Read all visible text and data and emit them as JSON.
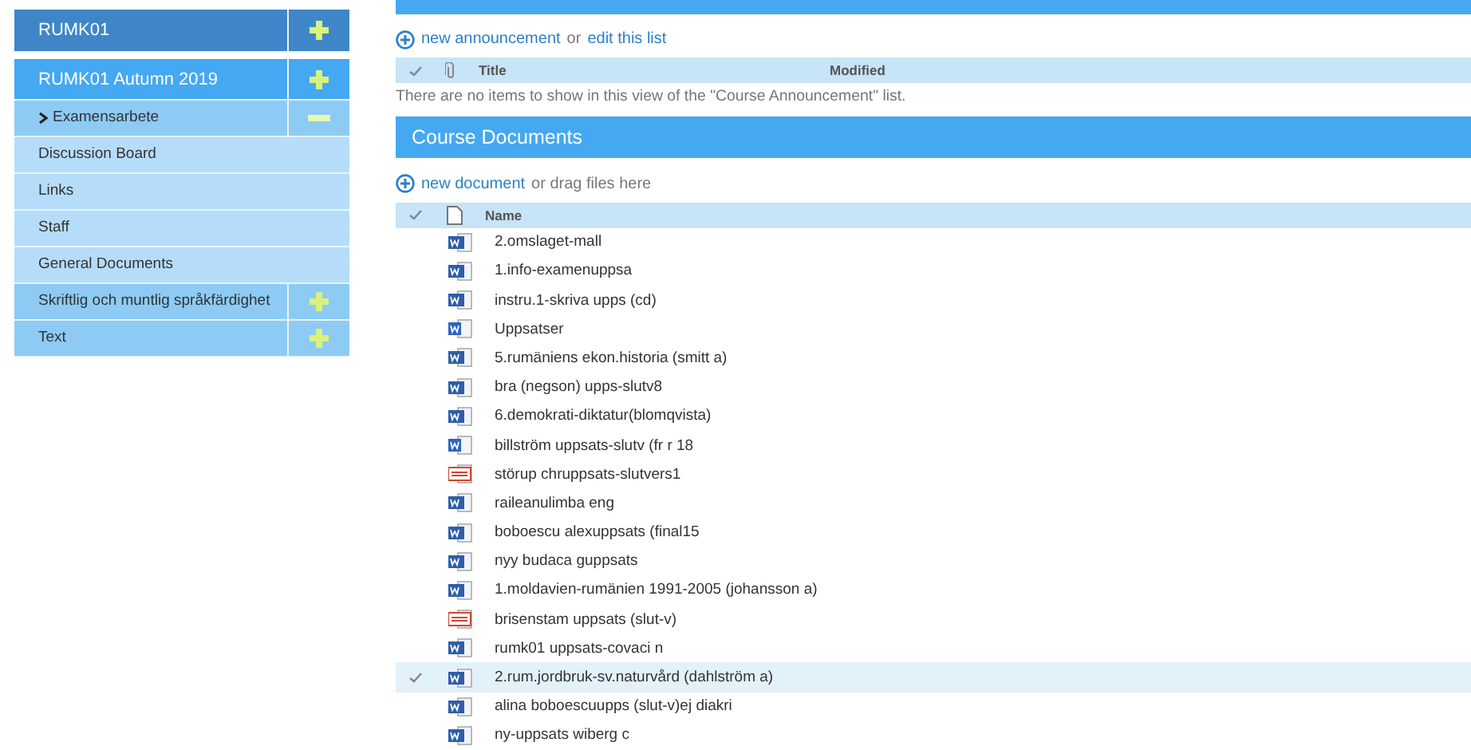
{
  "sidebar": {
    "items": [
      {
        "label": "RUMK01",
        "selected": false,
        "expanded": false,
        "children": [
          {
            "label": "RUMK01 Autumn 2019",
            "selected": false,
            "expanded": false,
            "children": [
              {
                "label": "Examensarbete",
                "selected": true,
                "expanded": true,
                "children": [
                  {
                    "label": "Discussion Board",
                    "selected": false
                  },
                  {
                    "label": "Links",
                    "selected": false
                  },
                  {
                    "label": "Staff",
                    "selected": false
                  },
                  {
                    "label": "General Documents",
                    "selected": false
                  }
                ]
              },
              {
                "label": "Skriftlig och muntlig språkfärdighet",
                "selected": false,
                "expanded": false
              },
              {
                "label": "Text",
                "selected": false,
                "expanded": false
              }
            ]
          }
        ]
      }
    ]
  },
  "announcements": {
    "new_link": "new announcement",
    "or_text": "or",
    "edit_link": "edit this list",
    "columns": [
      "Title",
      "Modified"
    ],
    "empty_message": "There are no items to show in this view of the \"Course Announcement\" list."
  },
  "documents": {
    "title": "Course Documents",
    "new_link": "new document",
    "or_text": "or drag files here",
    "columns": [
      "Name"
    ],
    "rows": [
      {
        "name": "2.omslaget-mall",
        "kind": "doc",
        "selected": false
      },
      {
        "name": "1.info-examenuppsa",
        "kind": "doc",
        "selected": false
      },
      {
        "name": "instru.1-skriva upps (cd)",
        "kind": "doc",
        "selected": false
      },
      {
        "name": "Uppsatser",
        "kind": "docx",
        "selected": false
      },
      {
        "name": "5.rumäniens ekon.historia (smitt a)",
        "kind": "doc",
        "selected": false
      },
      {
        "name": "bra (negson) upps-slutv8",
        "kind": "doc",
        "selected": false
      },
      {
        "name": "6.demokrati-diktatur(blomqvista)",
        "kind": "doc",
        "selected": false
      },
      {
        "name": "billström uppsats-slutv (fr r 18",
        "kind": "docx",
        "selected": false
      },
      {
        "name": "störup chruppsats-slutvers1",
        "kind": "pdf",
        "selected": false
      },
      {
        "name": "raileanulimba eng",
        "kind": "doc",
        "selected": false
      },
      {
        "name": "boboescu alexuppsats (final15",
        "kind": "doc",
        "selected": false
      },
      {
        "name": "nyy budaca guppsats",
        "kind": "doc",
        "selected": false
      },
      {
        "name": "1.moldavien-rumänien 1991-2005 (johansson a)",
        "kind": "doc",
        "selected": false
      },
      {
        "name": "brisenstam uppsats (slut-v)",
        "kind": "pdf",
        "selected": false
      },
      {
        "name": "rumk01 uppsats-covaci n",
        "kind": "doc",
        "selected": false
      },
      {
        "name": "2.rum.jordbruk-sv.naturvård (dahlström a)",
        "kind": "doc",
        "selected": true
      },
      {
        "name": "alina boboescuupps (slut-v)ej diakri",
        "kind": "doc",
        "selected": false
      },
      {
        "name": "ny-uppsats wiberg c",
        "kind": "doc",
        "selected": false
      }
    ]
  }
}
